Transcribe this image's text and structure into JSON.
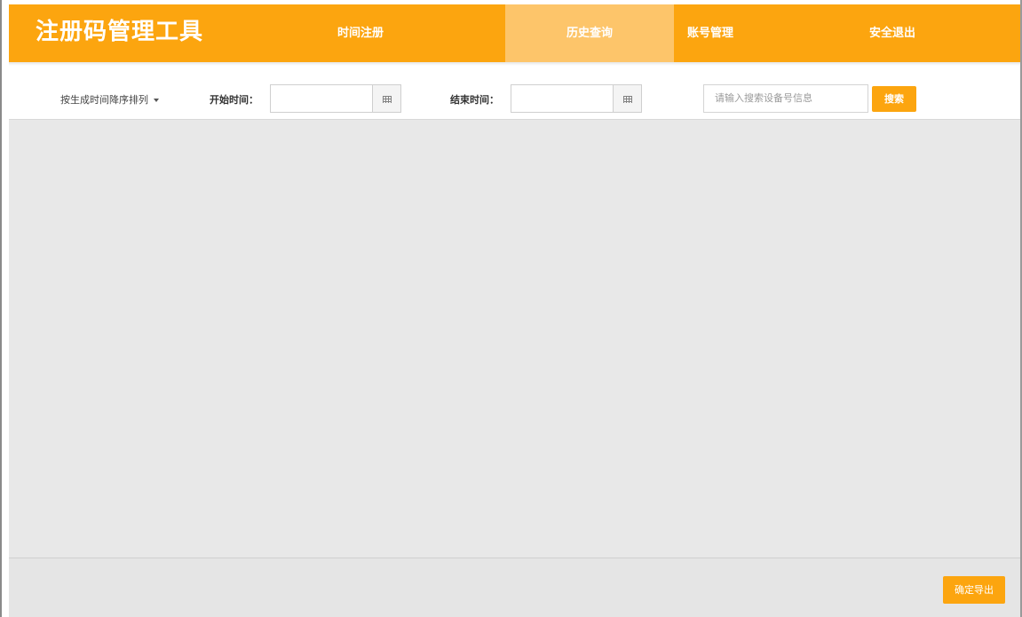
{
  "header": {
    "title": "注册码管理工具",
    "nav": [
      {
        "label": "时间注册",
        "active": false
      },
      {
        "label": "历史查询",
        "active": true
      },
      {
        "label": "账号管理",
        "active": false
      },
      {
        "label": "安全退出",
        "active": false
      }
    ]
  },
  "toolbar": {
    "sort_label": "按生成时间降序排列",
    "start_label": "开始时间：",
    "start_value": "",
    "end_label": "结束时间：",
    "end_value": "",
    "search_placeholder": "请输入搜索设备号信息",
    "search_button": "搜索"
  },
  "footer": {
    "export_button": "确定导出"
  },
  "colors": {
    "accent": "#fca50f",
    "active_tab": "#fdc56a",
    "content_bg": "#e8e8e8"
  }
}
